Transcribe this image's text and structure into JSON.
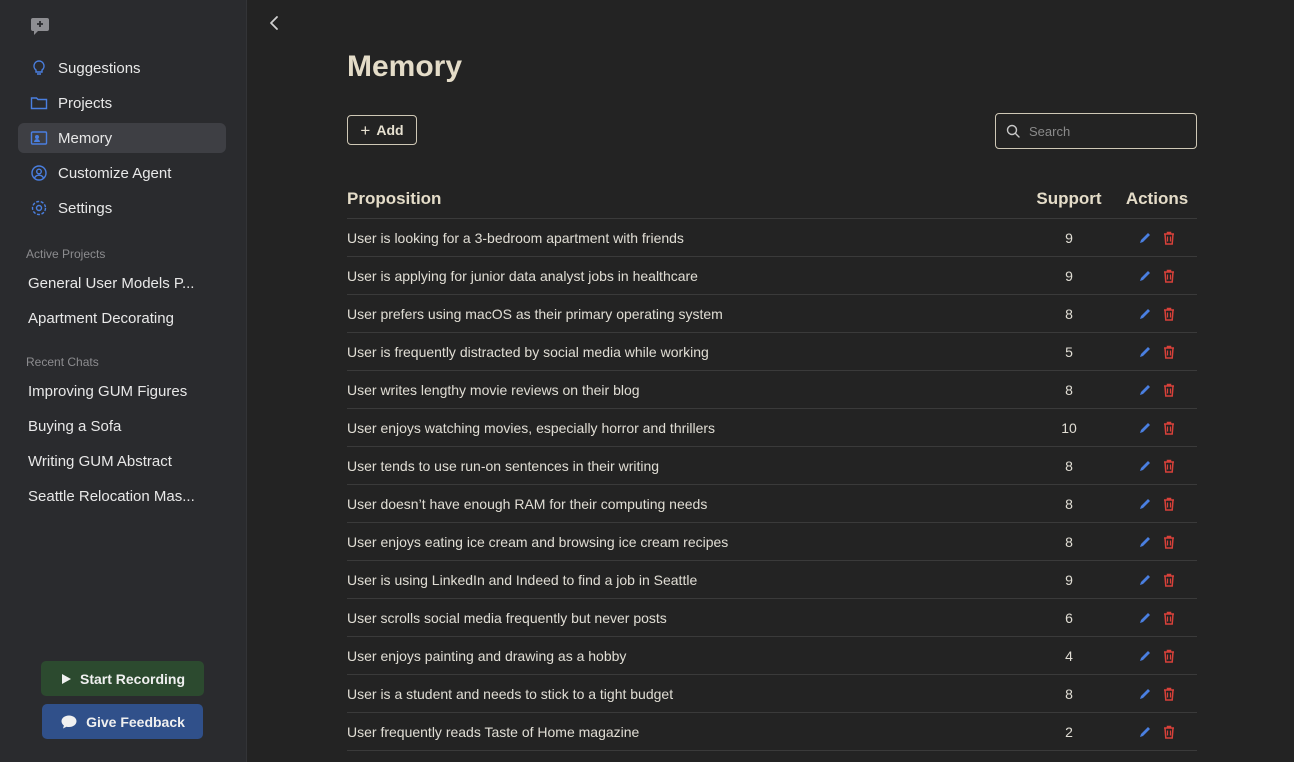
{
  "sidebar": {
    "nav": [
      {
        "label": "Suggestions",
        "icon": "lightbulb-icon"
      },
      {
        "label": "Projects",
        "icon": "folder-icon"
      },
      {
        "label": "Memory",
        "icon": "memory-icon",
        "active": true
      },
      {
        "label": "Customize Agent",
        "icon": "user-circle-icon"
      },
      {
        "label": "Settings",
        "icon": "gear-icon"
      }
    ],
    "active_projects_title": "Active Projects",
    "active_projects": [
      "General User Models P...",
      "Apartment Decorating"
    ],
    "recent_chats_title": "Recent Chats",
    "recent_chats": [
      "Improving GUM Figures",
      "Buying a Sofa",
      "Writing GUM Abstract",
      "Seattle Relocation Mas..."
    ],
    "start_recording_label": "Start Recording",
    "give_feedback_label": "Give Feedback"
  },
  "main": {
    "title": "Memory",
    "add_label": "Add",
    "search_placeholder": "Search",
    "table": {
      "headers": {
        "proposition": "Proposition",
        "support": "Support",
        "actions": "Actions"
      },
      "rows": [
        {
          "proposition": "User is looking for a 3-bedroom apartment with friends",
          "support": "9"
        },
        {
          "proposition": "User is applying for junior data analyst jobs in healthcare",
          "support": "9"
        },
        {
          "proposition": "User prefers using macOS as their primary operating system",
          "support": "8"
        },
        {
          "proposition": "User is frequently distracted by social media while working",
          "support": "5"
        },
        {
          "proposition": "User writes lengthy movie reviews on their blog",
          "support": "8"
        },
        {
          "proposition": "User enjoys watching movies, especially horror and thrillers",
          "support": "10"
        },
        {
          "proposition": "User tends to use run-on sentences in their writing",
          "support": "8"
        },
        {
          "proposition": "User doesn’t have enough RAM for their computing needs",
          "support": "8"
        },
        {
          "proposition": "User enjoys eating ice cream and browsing ice cream recipes",
          "support": "8"
        },
        {
          "proposition": "User is using LinkedIn and Indeed to find a job in Seattle",
          "support": "9"
        },
        {
          "proposition": "User scrolls social media frequently but never posts",
          "support": "6"
        },
        {
          "proposition": "User enjoys painting and drawing as a hobby",
          "support": "4"
        },
        {
          "proposition": "User is a student and needs to stick to a tight budget",
          "support": "8"
        },
        {
          "proposition": "User frequently reads Taste of Home magazine",
          "support": "2"
        }
      ]
    }
  },
  "colors": {
    "accent_blue": "#4a7fe0",
    "delete_red": "#d8413a",
    "record_green": "#2c4a2f",
    "feedback_blue": "#30508a"
  }
}
